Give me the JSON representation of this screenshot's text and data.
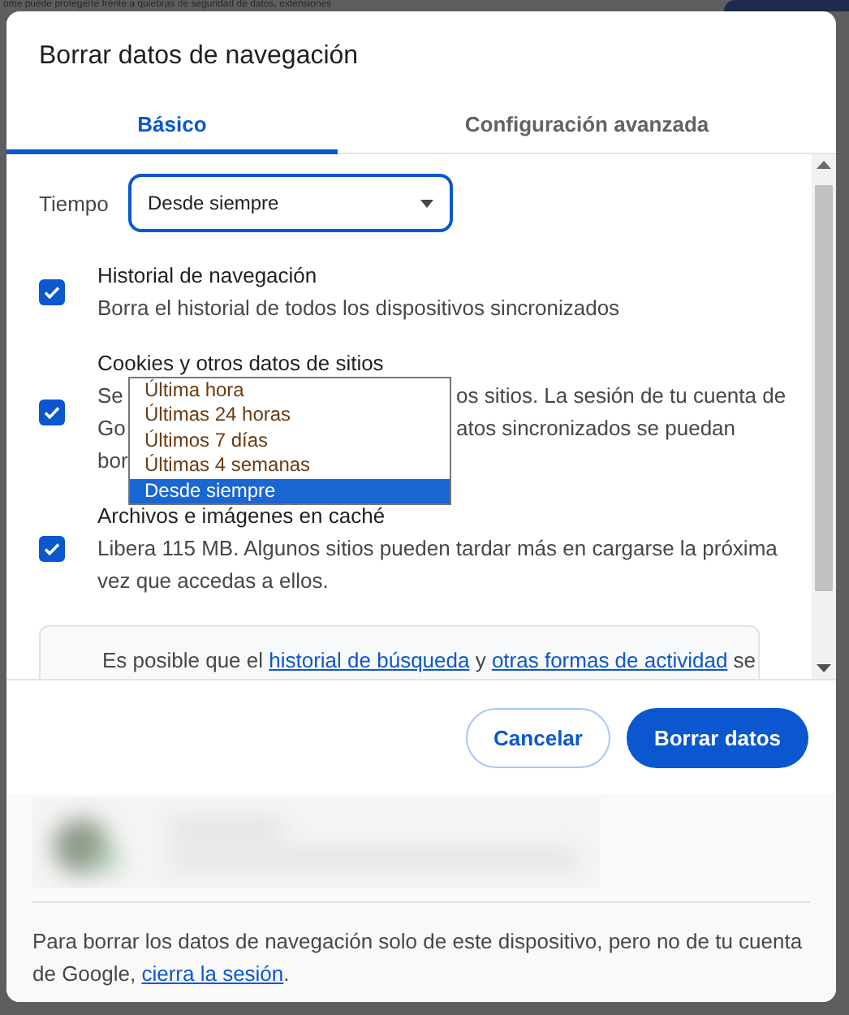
{
  "background": {
    "text": "ome puede protegerte frente a quiebras de seguridad de datos, extensiones"
  },
  "dialog": {
    "title": "Borrar datos de navegación"
  },
  "tabs": [
    {
      "label": "Básico",
      "selected": true
    },
    {
      "label": "Configuración avanzada",
      "selected": false
    }
  ],
  "time_range": {
    "label": "Tiempo",
    "value": "Desde siempre",
    "expanded": true,
    "options": [
      {
        "label": "Última hora",
        "selected": false
      },
      {
        "label": "Últimas 24 horas",
        "selected": false
      },
      {
        "label": "Últimos 7 días",
        "selected": false
      },
      {
        "label": "Últimas 4 semanas",
        "selected": false
      },
      {
        "label": "Desde siempre",
        "selected": true
      }
    ]
  },
  "items": [
    {
      "kind": "plain",
      "title": "Historial de navegación",
      "description": "Borra el historial de todos los dispositivos sincronizados",
      "checked": true
    },
    {
      "kind": "covered",
      "title": "Cookies y otros datos de sitios",
      "lines": [
        {
          "left": "Se",
          "right": "os sitios. La sesión de tu cuenta de"
        },
        {
          "left": "Go",
          "right": "atos sincronizados se puedan"
        },
        {
          "left": "bor"
        }
      ],
      "checked": true
    },
    {
      "kind": "plain",
      "title": "Archivos e imágenes en caché",
      "description": "Libera 115 MB. Algunos sitios pueden tardar más en cargarse la próxima vez que accedas a ellos.",
      "checked": true
    }
  ],
  "info": {
    "parts": [
      {
        "text": "Es posible que el "
      },
      {
        "text": "historial de búsqueda",
        "link": true
      },
      {
        "text": " y "
      },
      {
        "text": "otras formas de actividad",
        "link": true
      },
      {
        "text": " se"
      }
    ]
  },
  "buttons": [
    {
      "label": "Cancelar",
      "kind": "secondary"
    },
    {
      "label": "Borrar datos",
      "kind": "primary"
    }
  ],
  "footer_note": {
    "parts": [
      {
        "text": "Para borrar los datos de navegación solo de este dispositivo, pero no de tu cuenta de Google, "
      },
      {
        "text": "cierra la sesión",
        "link": true
      },
      {
        "text": "."
      }
    ]
  }
}
